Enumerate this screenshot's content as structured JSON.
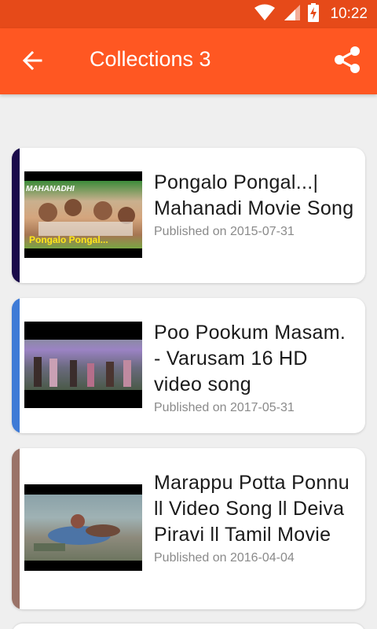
{
  "status_bar": {
    "time": "10:22",
    "icons": [
      "wifi-icon",
      "cell-signal-icon",
      "battery-charging-icon"
    ]
  },
  "app_bar": {
    "title": "Collections 3",
    "back_icon": "arrow-back-icon",
    "share_icon": "share-icon",
    "color": "#ff5722",
    "status_color": "#e64a19"
  },
  "videos": [
    {
      "title": "Pongalo Pongal...| Mahanadi Movie Song",
      "date": "Published on 2015-07-31",
      "accent": "#1a0a4a",
      "thumb_caption": "Pongalo Pongal...",
      "thumb_logo": "MAHANADHI"
    },
    {
      "title": "Poo Pookum Masam. - Varusam 16 HD video song",
      "date": "Published on 2017-05-31",
      "accent": "#3f7bd6"
    },
    {
      "title": "Marappu Potta Ponnu ll Video Song ll Deiva Piravi ll Tamil Movie",
      "date": "Published on 2016-04-04",
      "accent": "#9a7368"
    }
  ]
}
